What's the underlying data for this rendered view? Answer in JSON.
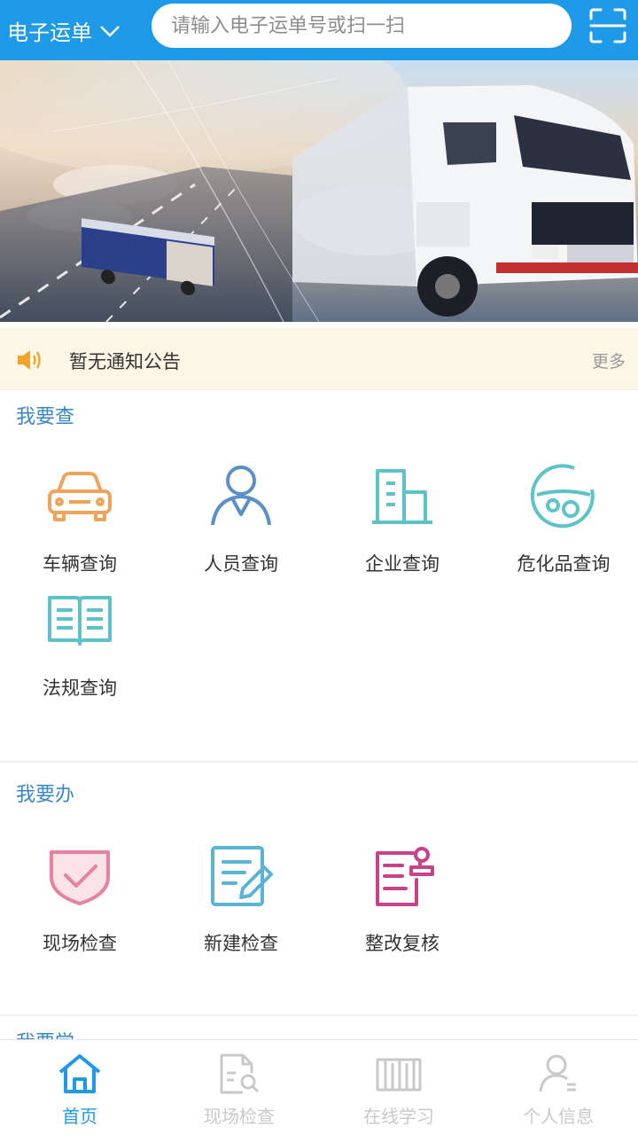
{
  "header": {
    "type_selector_label": "电子运单",
    "search_placeholder": "请输入电子运单号或扫一扫",
    "scan_icon": "scan-frame-icon"
  },
  "notice": {
    "text": "暂无通知公告",
    "more_label": "更多",
    "icon": "speaker-icon"
  },
  "sections": {
    "query": {
      "title": "我要查",
      "items": [
        {
          "label": "车辆查询",
          "icon": "car-icon",
          "color": "#f0a35a"
        },
        {
          "label": "人员查询",
          "icon": "person-icon",
          "color": "#5b8fc9"
        },
        {
          "label": "企业查询",
          "icon": "building-icon",
          "color": "#5cc3c9"
        },
        {
          "label": "危化品查询",
          "icon": "hazmat-icon",
          "color": "#5cc3c9"
        },
        {
          "label": "法规查询",
          "icon": "book-icon",
          "color": "#5cc3c9"
        }
      ]
    },
    "handle": {
      "title": "我要办",
      "items": [
        {
          "label": "现场检查",
          "icon": "shield-check-icon",
          "color": "#e8829a"
        },
        {
          "label": "新建检查",
          "icon": "edit-doc-icon",
          "color": "#5ab4d6"
        },
        {
          "label": "整改复核",
          "icon": "doc-stamp-icon",
          "color": "#c9418a"
        }
      ]
    },
    "next_title_peek": "我要学"
  },
  "tabbar": {
    "items": [
      {
        "label": "首页",
        "icon": "home-icon",
        "active": true
      },
      {
        "label": "现场检查",
        "icon": "doc-search-icon",
        "active": false
      },
      {
        "label": "在线学习",
        "icon": "bookshelf-icon",
        "active": false
      },
      {
        "label": "个人信息",
        "icon": "user-icon",
        "active": false
      }
    ]
  },
  "colors": {
    "primary": "#1e9ae8",
    "section_title": "#3a87c8",
    "notice_bg": "#fbf6e5",
    "tab_inactive": "#c9c9c9"
  }
}
